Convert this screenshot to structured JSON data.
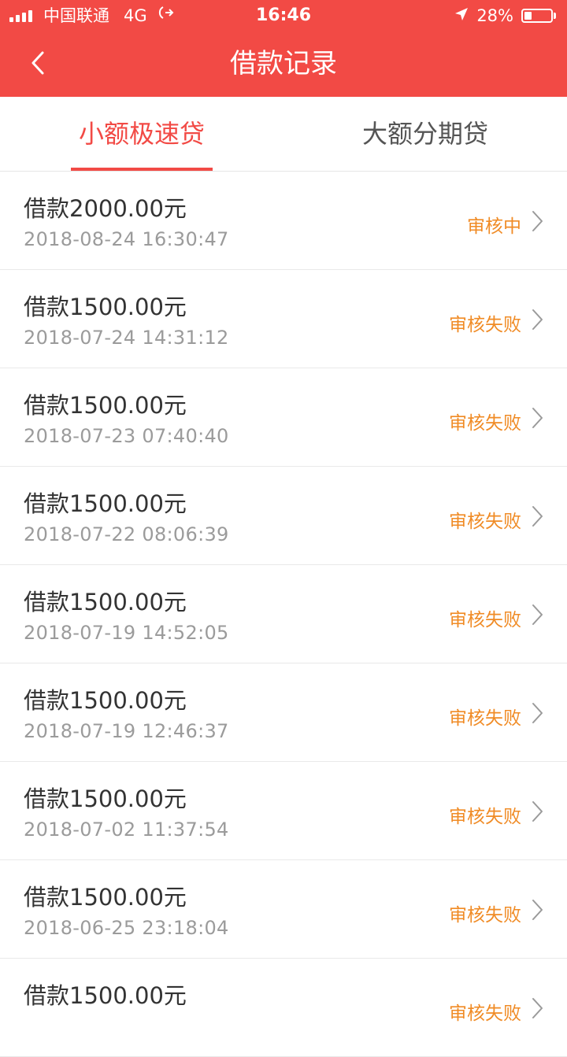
{
  "status_bar": {
    "carrier": "中国联通",
    "network": "4G",
    "time": "16:46",
    "battery": "28%",
    "battery_level": 0.28
  },
  "nav": {
    "title": "借款记录",
    "back_icon": "chevron-left-icon"
  },
  "tabs": [
    {
      "label": "小额极速贷",
      "active": true
    },
    {
      "label": "大额分期贷",
      "active": false
    }
  ],
  "records": [
    {
      "amount": "借款2000.00元",
      "time": "2018-08-24 16:30:47",
      "status": "审核中"
    },
    {
      "amount": "借款1500.00元",
      "time": "2018-07-24 14:31:12",
      "status": "审核失败"
    },
    {
      "amount": "借款1500.00元",
      "time": "2018-07-23 07:40:40",
      "status": "审核失败"
    },
    {
      "amount": "借款1500.00元",
      "time": "2018-07-22 08:06:39",
      "status": "审核失败"
    },
    {
      "amount": "借款1500.00元",
      "time": "2018-07-19 14:52:05",
      "status": "审核失败"
    },
    {
      "amount": "借款1500.00元",
      "time": "2018-07-19 12:46:37",
      "status": "审核失败"
    },
    {
      "amount": "借款1500.00元",
      "time": "2018-07-02 11:37:54",
      "status": "审核失败"
    },
    {
      "amount": "借款1500.00元",
      "time": "2018-06-25 23:18:04",
      "status": "审核失败"
    },
    {
      "amount": "借款1500.00元",
      "time": "",
      "status": "审核失败"
    }
  ],
  "colors": {
    "brand": "#f24a45",
    "status": "#f08b25"
  }
}
